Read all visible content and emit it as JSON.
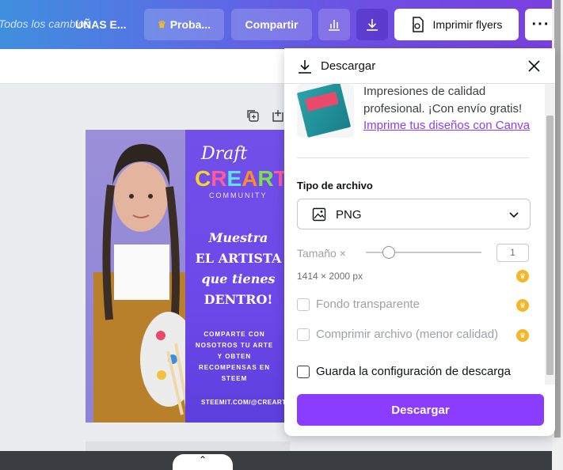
{
  "topbar": {
    "saved_text": "Todos los cambios",
    "doc_title": "UÑAS E...",
    "try_pro_label": "Proba...",
    "share_label": "Compartir",
    "print_label": "Imprimir flyers",
    "icons": [
      "crown-icon",
      "chart-icon",
      "download-icon",
      "print-icon",
      "more-icon"
    ]
  },
  "flyer": {
    "draft": "Draft",
    "brand": "CREARTE",
    "community": "COMMUNITY",
    "headline": [
      "Muestra",
      "EL ARTISTA",
      "que tienes",
      "DENTRO!"
    ],
    "small": [
      "COMPARTE CON",
      "NOSOTROS TU ARTE",
      "Y OBTEN",
      "RECOMPENSAS EN",
      "STEEM"
    ],
    "site": "STEEMIT.COM/@CREARTE"
  },
  "download_panel": {
    "title": "Descargar",
    "promo_text": "Impresiones de calidad profesional. ¡Con envío gratis!",
    "promo_link": "Imprime tus diseños con Canva",
    "file_type_label": "Tipo de archivo",
    "file_type_value": "PNG",
    "size_label": "Tamaño ×",
    "size_value": "1",
    "dimensions": "1414 × 2000 px",
    "options": [
      {
        "label": "Fondo transparente",
        "checked": false,
        "disabled": true
      },
      {
        "label": "Comprimir archivo (menor calidad)",
        "checked": false,
        "disabled": true
      },
      {
        "label": "Guarda la configuración de descarga",
        "checked": false,
        "disabled": false
      }
    ],
    "download_button": "Descargar"
  },
  "colors": {
    "accent": "#8b3dff",
    "crown": "#f3b72a"
  }
}
